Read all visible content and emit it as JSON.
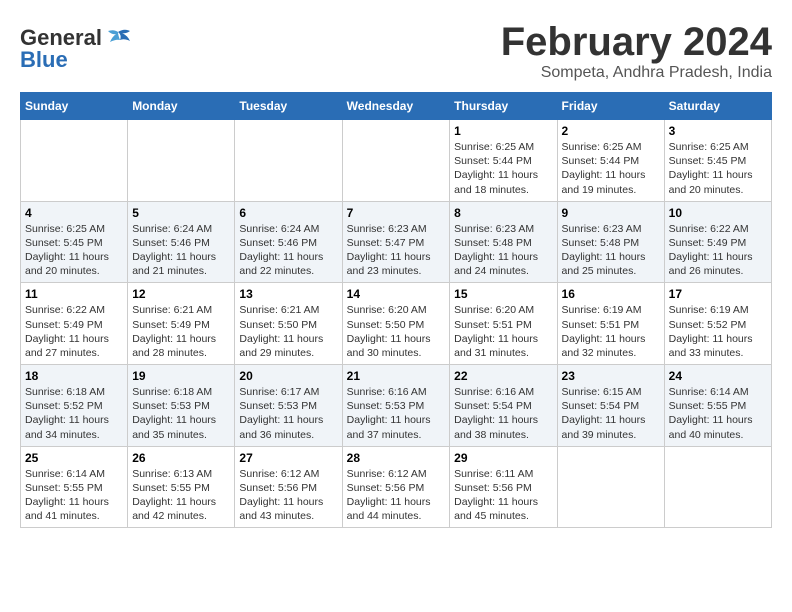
{
  "header": {
    "logo_general": "General",
    "logo_blue": "Blue",
    "month_title": "February 2024",
    "location": "Sompeta, Andhra Pradesh, India"
  },
  "days_of_week": [
    "Sunday",
    "Monday",
    "Tuesday",
    "Wednesday",
    "Thursday",
    "Friday",
    "Saturday"
  ],
  "weeks": [
    [
      {
        "day": "",
        "info": ""
      },
      {
        "day": "",
        "info": ""
      },
      {
        "day": "",
        "info": ""
      },
      {
        "day": "",
        "info": ""
      },
      {
        "day": "1",
        "info": "Sunrise: 6:25 AM\nSunset: 5:44 PM\nDaylight: 11 hours and 18 minutes."
      },
      {
        "day": "2",
        "info": "Sunrise: 6:25 AM\nSunset: 5:44 PM\nDaylight: 11 hours and 19 minutes."
      },
      {
        "day": "3",
        "info": "Sunrise: 6:25 AM\nSunset: 5:45 PM\nDaylight: 11 hours and 20 minutes."
      }
    ],
    [
      {
        "day": "4",
        "info": "Sunrise: 6:25 AM\nSunset: 5:45 PM\nDaylight: 11 hours and 20 minutes."
      },
      {
        "day": "5",
        "info": "Sunrise: 6:24 AM\nSunset: 5:46 PM\nDaylight: 11 hours and 21 minutes."
      },
      {
        "day": "6",
        "info": "Sunrise: 6:24 AM\nSunset: 5:46 PM\nDaylight: 11 hours and 22 minutes."
      },
      {
        "day": "7",
        "info": "Sunrise: 6:23 AM\nSunset: 5:47 PM\nDaylight: 11 hours and 23 minutes."
      },
      {
        "day": "8",
        "info": "Sunrise: 6:23 AM\nSunset: 5:48 PM\nDaylight: 11 hours and 24 minutes."
      },
      {
        "day": "9",
        "info": "Sunrise: 6:23 AM\nSunset: 5:48 PM\nDaylight: 11 hours and 25 minutes."
      },
      {
        "day": "10",
        "info": "Sunrise: 6:22 AM\nSunset: 5:49 PM\nDaylight: 11 hours and 26 minutes."
      }
    ],
    [
      {
        "day": "11",
        "info": "Sunrise: 6:22 AM\nSunset: 5:49 PM\nDaylight: 11 hours and 27 minutes."
      },
      {
        "day": "12",
        "info": "Sunrise: 6:21 AM\nSunset: 5:49 PM\nDaylight: 11 hours and 28 minutes."
      },
      {
        "day": "13",
        "info": "Sunrise: 6:21 AM\nSunset: 5:50 PM\nDaylight: 11 hours and 29 minutes."
      },
      {
        "day": "14",
        "info": "Sunrise: 6:20 AM\nSunset: 5:50 PM\nDaylight: 11 hours and 30 minutes."
      },
      {
        "day": "15",
        "info": "Sunrise: 6:20 AM\nSunset: 5:51 PM\nDaylight: 11 hours and 31 minutes."
      },
      {
        "day": "16",
        "info": "Sunrise: 6:19 AM\nSunset: 5:51 PM\nDaylight: 11 hours and 32 minutes."
      },
      {
        "day": "17",
        "info": "Sunrise: 6:19 AM\nSunset: 5:52 PM\nDaylight: 11 hours and 33 minutes."
      }
    ],
    [
      {
        "day": "18",
        "info": "Sunrise: 6:18 AM\nSunset: 5:52 PM\nDaylight: 11 hours and 34 minutes."
      },
      {
        "day": "19",
        "info": "Sunrise: 6:18 AM\nSunset: 5:53 PM\nDaylight: 11 hours and 35 minutes."
      },
      {
        "day": "20",
        "info": "Sunrise: 6:17 AM\nSunset: 5:53 PM\nDaylight: 11 hours and 36 minutes."
      },
      {
        "day": "21",
        "info": "Sunrise: 6:16 AM\nSunset: 5:53 PM\nDaylight: 11 hours and 37 minutes."
      },
      {
        "day": "22",
        "info": "Sunrise: 6:16 AM\nSunset: 5:54 PM\nDaylight: 11 hours and 38 minutes."
      },
      {
        "day": "23",
        "info": "Sunrise: 6:15 AM\nSunset: 5:54 PM\nDaylight: 11 hours and 39 minutes."
      },
      {
        "day": "24",
        "info": "Sunrise: 6:14 AM\nSunset: 5:55 PM\nDaylight: 11 hours and 40 minutes."
      }
    ],
    [
      {
        "day": "25",
        "info": "Sunrise: 6:14 AM\nSunset: 5:55 PM\nDaylight: 11 hours and 41 minutes."
      },
      {
        "day": "26",
        "info": "Sunrise: 6:13 AM\nSunset: 5:55 PM\nDaylight: 11 hours and 42 minutes."
      },
      {
        "day": "27",
        "info": "Sunrise: 6:12 AM\nSunset: 5:56 PM\nDaylight: 11 hours and 43 minutes."
      },
      {
        "day": "28",
        "info": "Sunrise: 6:12 AM\nSunset: 5:56 PM\nDaylight: 11 hours and 44 minutes."
      },
      {
        "day": "29",
        "info": "Sunrise: 6:11 AM\nSunset: 5:56 PM\nDaylight: 11 hours and 45 minutes."
      },
      {
        "day": "",
        "info": ""
      },
      {
        "day": "",
        "info": ""
      }
    ]
  ]
}
